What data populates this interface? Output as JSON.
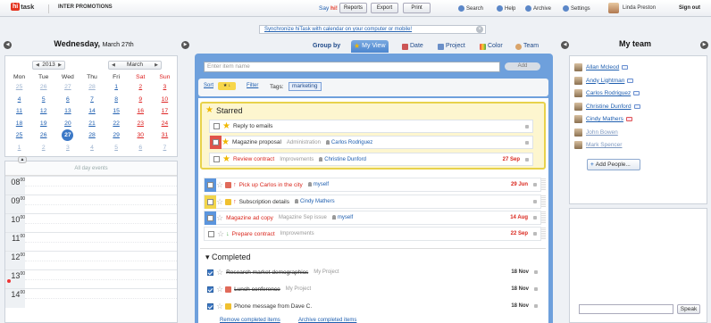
{
  "app": {
    "logo_hi": "hi",
    "logo_task": "task",
    "company": "INTER PROMOTIONS"
  },
  "topbar": {
    "sayhi_prefix": "Say ",
    "sayhi_bold": "hi!",
    "buttons": [
      "Reports",
      "Export",
      "Print"
    ],
    "links": [
      "Search",
      "Help",
      "Archive",
      "Settings"
    ],
    "user": "Linda Preston",
    "signout": "Sign out"
  },
  "sync": {
    "text": "Synchronize hiTask with calendar on your computer or mobile!",
    "close": "×"
  },
  "calendar": {
    "day_name": "Wednesday,",
    "date": "March 27th",
    "year": "2013",
    "month": "March",
    "weekdays": [
      "Mon",
      "Tue",
      "Wed",
      "Thu",
      "Fri",
      "Sat",
      "Sun"
    ],
    "weeks": [
      [
        {
          "d": "25",
          "t": "o"
        },
        {
          "d": "26",
          "t": "o"
        },
        {
          "d": "27",
          "t": "o"
        },
        {
          "d": "28",
          "t": "o"
        },
        {
          "d": "1",
          "t": "d"
        },
        {
          "d": "2",
          "t": "w"
        },
        {
          "d": "3",
          "t": "w"
        }
      ],
      [
        {
          "d": "4",
          "t": "d"
        },
        {
          "d": "5",
          "t": "d"
        },
        {
          "d": "6",
          "t": "d"
        },
        {
          "d": "7",
          "t": "d"
        },
        {
          "d": "8",
          "t": "d"
        },
        {
          "d": "9",
          "t": "w"
        },
        {
          "d": "10",
          "t": "w"
        }
      ],
      [
        {
          "d": "11",
          "t": "d"
        },
        {
          "d": "12",
          "t": "d"
        },
        {
          "d": "13",
          "t": "d"
        },
        {
          "d": "14",
          "t": "d"
        },
        {
          "d": "15",
          "t": "d"
        },
        {
          "d": "16",
          "t": "w"
        },
        {
          "d": "17",
          "t": "w"
        }
      ],
      [
        {
          "d": "18",
          "t": "d"
        },
        {
          "d": "19",
          "t": "d"
        },
        {
          "d": "20",
          "t": "d"
        },
        {
          "d": "21",
          "t": "d"
        },
        {
          "d": "22",
          "t": "d"
        },
        {
          "d": "23",
          "t": "w"
        },
        {
          "d": "24",
          "t": "w"
        }
      ],
      [
        {
          "d": "25",
          "t": "d"
        },
        {
          "d": "26",
          "t": "d"
        },
        {
          "d": "27",
          "t": "today"
        },
        {
          "d": "28",
          "t": "d"
        },
        {
          "d": "29",
          "t": "d"
        },
        {
          "d": "30",
          "t": "w"
        },
        {
          "d": "31",
          "t": "w"
        }
      ],
      [
        {
          "d": "1",
          "t": "o"
        },
        {
          "d": "2",
          "t": "o"
        },
        {
          "d": "3",
          "t": "o"
        },
        {
          "d": "4",
          "t": "o"
        },
        {
          "d": "5",
          "t": "o"
        },
        {
          "d": "6",
          "t": "o"
        },
        {
          "d": "7",
          "t": "o"
        }
      ]
    ],
    "allday": "All day events",
    "hours": [
      "08",
      "09",
      "10",
      "11",
      "12",
      "13",
      "14"
    ],
    "minutes": "00"
  },
  "groupby": {
    "label": "Group by",
    "tabs": [
      "My View",
      "Date",
      "Project",
      "Color",
      "Team"
    ]
  },
  "newitem": {
    "placeholder": "Enter item name",
    "add": "Add"
  },
  "filterbar": {
    "sort": "Sort",
    "sort_chip": "★ ↓",
    "filter": "Filter",
    "tags_label": "Tags:",
    "tag": "marketing"
  },
  "starred": {
    "title": "Starred",
    "items": [
      {
        "title": "Reply to emails",
        "project": "",
        "assignee": "",
        "due": "",
        "color": "",
        "red": false
      },
      {
        "title": "Magazine proposal",
        "project": "Administration",
        "assignee": "Carlos Rodriguez",
        "due": "",
        "color": "#e0544a",
        "red": false
      },
      {
        "title": "Review contract",
        "project": "Improvements",
        "assignee": "Christine Dunford",
        "due": "27 Sep",
        "color": "",
        "red": true
      }
    ]
  },
  "tasks": [
    {
      "title": "Pick up Carlos in the city",
      "project": "",
      "assignee": "myself",
      "due": "29 Jun",
      "color": "#5b95dd",
      "red": true
    },
    {
      "title": "Subscription details",
      "project": "",
      "assignee": "Cindy Mathers",
      "due": "",
      "color": "#f1d54c",
      "red": false
    },
    {
      "title": "Magazine ad copy",
      "project": "Magazine Sep issue",
      "assignee": "myself",
      "due": "14 Aug",
      "color": "#5b95dd",
      "red": true
    },
    {
      "title": "Prepare contract",
      "project": "Improvements",
      "assignee": "",
      "due": "22 Sep",
      "color": "",
      "red": true
    }
  ],
  "completed": {
    "title": "Completed",
    "items": [
      {
        "title": "Research market demographics",
        "project": "My Project",
        "due": "18 Nov"
      },
      {
        "title": "Lunch conference",
        "project": "My Project",
        "due": "18 Nov"
      },
      {
        "title": "Phone message from Dave C.",
        "project": "",
        "due": "18 Nov"
      }
    ],
    "remove": "Remove completed items",
    "archive": "Archive completed items"
  },
  "team": {
    "title": "My team",
    "members": [
      {
        "name": "Allan Mcleod",
        "state": "on"
      },
      {
        "name": "Andy Lightman",
        "state": "on"
      },
      {
        "name": "Carlos Rodriguez",
        "state": "on"
      },
      {
        "name": "Christine Dunford",
        "state": "on"
      },
      {
        "name": "Cindy Mathers",
        "state": "red"
      },
      {
        "name": "John Bowen",
        "state": "off"
      },
      {
        "name": "Mark Spencer",
        "state": "off"
      }
    ],
    "add_people": "Add People...",
    "speak": "Speak"
  },
  "colors": {
    "accent": "#6ea0dc",
    "star": "#f0b800",
    "due_red": "#d9261c",
    "starred_bg": "#fdf6cf"
  }
}
